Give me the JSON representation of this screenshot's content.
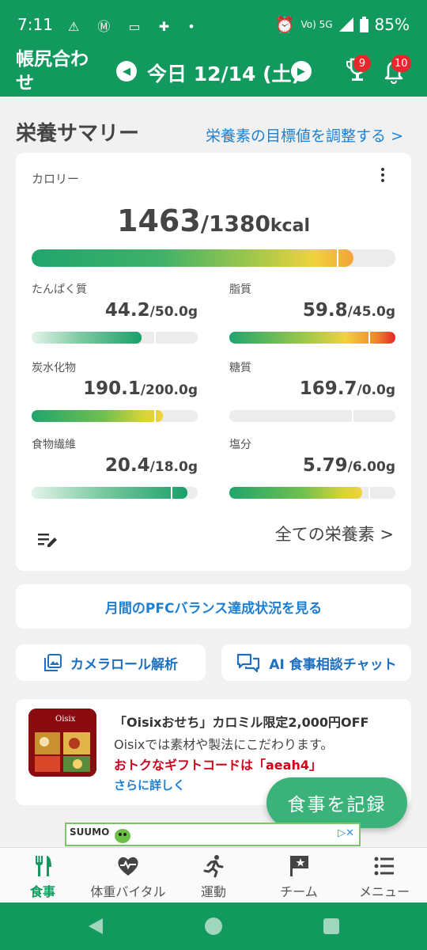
{
  "status_bar": {
    "time": "7:11",
    "icons": [
      "alert-icon",
      "motorola-icon",
      "wallet-icon",
      "game-icon",
      "dot-icon"
    ],
    "network_small": "Vo) 5G",
    "network_sub": "LTE",
    "battery": "85%"
  },
  "header": {
    "title": "帳尻合わせ",
    "date_label": "今日 12/14 (土)",
    "trophy_badge": "9",
    "bell_badge": "10"
  },
  "summary": {
    "title": "栄養サマリー",
    "adjust_link": "栄養素の目標値を調整する >",
    "calorie": {
      "label": "カロリー",
      "value": "1463",
      "target": "/1380",
      "unit": "kcal",
      "progress": 0.885,
      "target_mark": 0.84
    },
    "nutrients": [
      {
        "label": "たんぱく質",
        "value": "44.2",
        "target": "/50.0g",
        "progress": 0.66,
        "target_mark": 0.74,
        "style": "fade-green"
      },
      {
        "label": "脂質",
        "value": "59.8",
        "target": "/45.0g",
        "progress": 1.0,
        "target_mark": 0.84,
        "style": "over"
      },
      {
        "label": "炭水化物",
        "value": "190.1",
        "target": "/200.0g",
        "progress": 0.79,
        "target_mark": 0.74,
        "style": "normal"
      },
      {
        "label": "糖質",
        "value": "169.7",
        "target": "/0.0g",
        "progress": 0.0,
        "target_mark": 0.74,
        "style": "normal"
      },
      {
        "label": "食物繊維",
        "value": "20.4",
        "target": "/18.0g",
        "progress": 0.94,
        "target_mark": 0.84,
        "style": "fade-green"
      },
      {
        "label": "塩分",
        "value": "5.79",
        "target": "/6.00g",
        "progress": 0.8,
        "target_mark": 0.84,
        "style": "normal"
      }
    ],
    "all_nutrients_link": "全ての栄養素 >"
  },
  "pfc_button": "月間のPFCバランス達成状況を見る",
  "camera_button": "カメラロール解析",
  "chat_button": "AI 食事相談チャット",
  "ad": {
    "title": "「Oisixおせち」カロミル限定2,000円OFF",
    "description": "Oisixでは素材や製法にこだわります。",
    "promo": "おトクなギフトコードは「aeah4」",
    "more": "さらに詳しく",
    "image_brand": "Oisix"
  },
  "fab_label": "食事を記録",
  "banner": {
    "logo": "SUUMO",
    "ad_mark": "▷✕"
  },
  "tabs": [
    {
      "label": "食事",
      "icon": "fork-knife-icon",
      "active": true
    },
    {
      "label": "体重バイタル",
      "icon": "heart-vital-icon",
      "active": false
    },
    {
      "label": "運動",
      "icon": "running-icon",
      "active": false
    },
    {
      "label": "チーム",
      "icon": "flag-star-icon",
      "active": false
    },
    {
      "label": "メニュー",
      "icon": "list-menu-icon",
      "active": false
    }
  ],
  "colors": {
    "brand": "#129a5e",
    "link": "#1f7fd0",
    "badge": "#e8262b",
    "promo": "#d0021b"
  }
}
